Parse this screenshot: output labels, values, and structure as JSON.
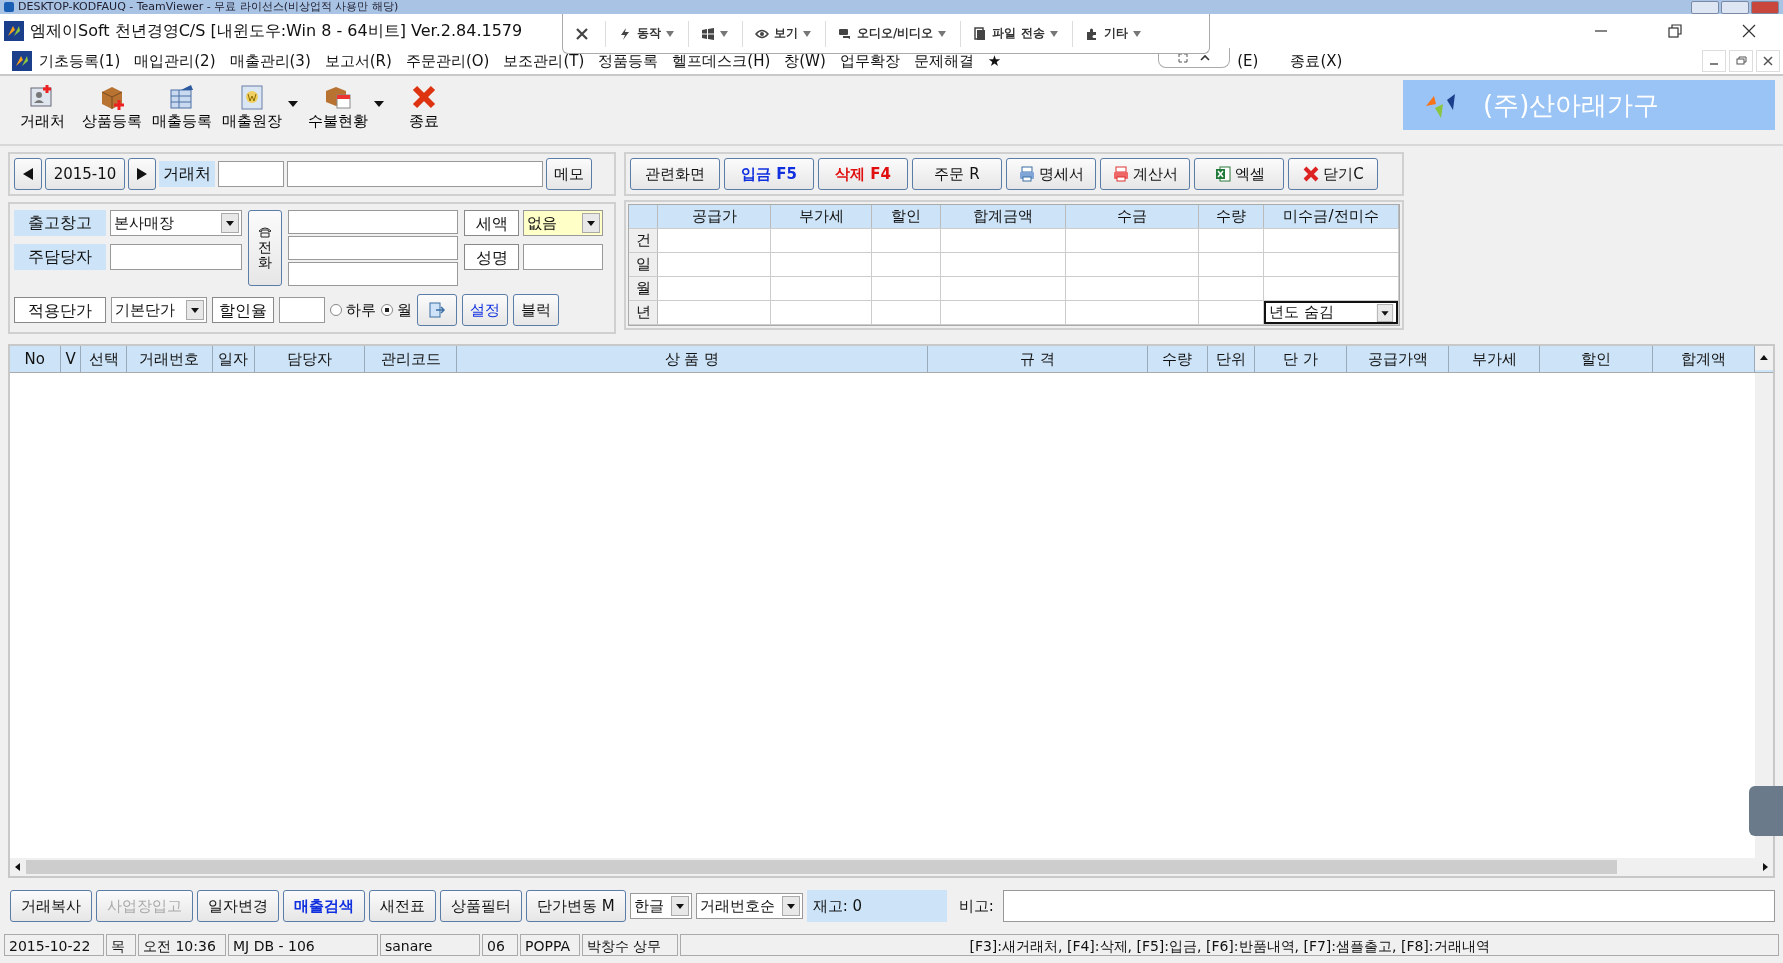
{
  "remote_session": {
    "title": "DESKTOP-KODFAUQ - TeamViewer - 무료 라이선스(비상업적 사용만 해당)"
  },
  "remote_toolbar": [
    {
      "kind": "lightning",
      "label": "동작"
    },
    {
      "kind": "windows"
    },
    {
      "kind": "eye",
      "label": "보기"
    },
    {
      "kind": "chat",
      "label": "오디오/비디오"
    },
    {
      "kind": "file",
      "label": "파일 전송"
    },
    {
      "kind": "puzzle",
      "label": "기타"
    }
  ],
  "window": {
    "title": "엠제이Soft 천년경영C/S [내윈도우:Win 8 - 64비트] Ver.2.84.1579"
  },
  "menu": [
    "기초등록(1)",
    "매입관리(2)",
    "매출관리(3)",
    "보고서(R)",
    "주문관리(O)",
    "보조관리(T)",
    "정품등록",
    "헬프데스크(H)",
    "창(W)",
    "업무확장",
    "문제해결",
    "★",
    "(E)",
    "종료(X)"
  ],
  "toolbar": [
    {
      "kind": "contact",
      "label": "거래처",
      "dropdown": false
    },
    {
      "kind": "box",
      "label": "상품등록",
      "dropdown": false
    },
    {
      "kind": "sales",
      "label": "매출등록",
      "dropdown": false
    },
    {
      "kind": "ledger",
      "label": "매출원장",
      "dropdown": true
    },
    {
      "kind": "calendar",
      "label": "수불현황",
      "dropdown": true
    },
    {
      "kind": "exit",
      "label": "종료",
      "dropdown": false
    }
  ],
  "company": {
    "name": "(주)산아래가구"
  },
  "period": {
    "value": "2015-10"
  },
  "customer": {
    "label": "거래처"
  },
  "memo_button": "메모",
  "form": {
    "warehouse_label": "출고창고",
    "warehouse": "본사매장",
    "manager_label": "주담당자",
    "phone_button": "전화",
    "tax_label": "세액",
    "tax": "없음",
    "name_label": "성명",
    "price_label": "적용단가",
    "price": "기본단가",
    "discount_label": "할인율",
    "period_radios": [
      {
        "label": "하루",
        "selected": false
      },
      {
        "label": "월",
        "selected": true
      }
    ],
    "settings_button": "설정",
    "block_button": "블럭"
  },
  "actions": [
    {
      "kind": "text",
      "label": "관련화면"
    },
    {
      "kind": "blue",
      "label": "입금 F5"
    },
    {
      "kind": "red",
      "label": "삭제 F4"
    },
    {
      "kind": "text",
      "label": "주문 R"
    },
    {
      "kind": "printer",
      "label": "명세서"
    },
    {
      "kind": "printer-red",
      "label": "계산서"
    },
    {
      "kind": "excel",
      "label": "엑셀"
    },
    {
      "kind": "close",
      "label": "닫기C"
    }
  ],
  "summary": {
    "columns": [
      "공급가",
      "부가세",
      "할인",
      "합계금액",
      "수금",
      "수량",
      "미수금/전미수"
    ],
    "rows": [
      "건",
      "일",
      "월",
      "년"
    ],
    "year_select": "년도 숨김"
  },
  "table": {
    "columns": [
      "No",
      "V",
      "선택",
      "거래번호",
      "일자",
      "담당자",
      "관리코드",
      "상 품 명",
      "규 격",
      "수량",
      "단위",
      "단 가",
      "공급가액",
      "부가세",
      "할인",
      "합계액"
    ]
  },
  "bottom_buttons": [
    {
      "label": "거래복사",
      "disabled": false,
      "highlight": false
    },
    {
      "label": "사업장입고",
      "disabled": true,
      "highlight": false
    },
    {
      "label": "일자변경",
      "disabled": false,
      "highlight": false
    },
    {
      "label": "매출검색",
      "disabled": false,
      "highlight": true
    },
    {
      "label": "새전표",
      "disabled": false,
      "highlight": false
    },
    {
      "label": "상품필터",
      "disabled": false,
      "highlight": false
    },
    {
      "label": "단가변동 M",
      "disabled": false,
      "highlight": false
    }
  ],
  "bottom_selects": [
    "한글",
    "거래번호순"
  ],
  "stock": "재고: 0",
  "remark_label": "비고:",
  "status_bar": [
    "2015-10-22",
    "목",
    "오전 10:36",
    "MJ DB - 106",
    "sanare",
    "06",
    "POPPA",
    "박창수 상무",
    "[F3]:새거래처, [F4]:삭제, [F5]:입금, [F6]:반품내역, [F7]:샘플출고, [F8]:거래내역"
  ]
}
